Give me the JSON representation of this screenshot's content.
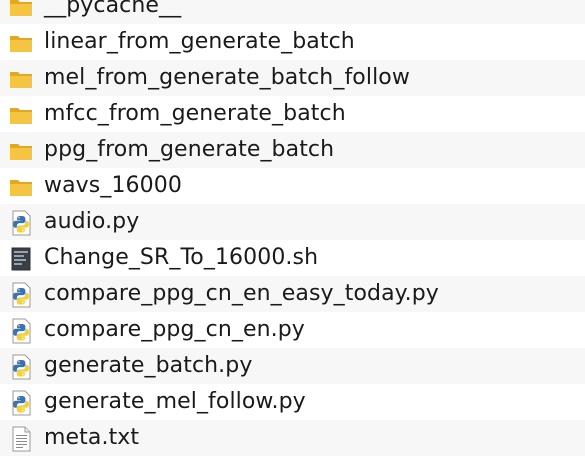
{
  "files": [
    {
      "name": "__pycache__",
      "kind": "folder"
    },
    {
      "name": "linear_from_generate_batch",
      "kind": "folder"
    },
    {
      "name": "mel_from_generate_batch_follow",
      "kind": "folder"
    },
    {
      "name": "mfcc_from_generate_batch",
      "kind": "folder"
    },
    {
      "name": "ppg_from_generate_batch",
      "kind": "folder"
    },
    {
      "name": "wavs_16000",
      "kind": "folder"
    },
    {
      "name": "audio.py",
      "kind": "python"
    },
    {
      "name": "Change_SR_To_16000.sh",
      "kind": "shell"
    },
    {
      "name": "compare_ppg_cn_en_easy_today.py",
      "kind": "python"
    },
    {
      "name": "compare_ppg_cn_en.py",
      "kind": "python"
    },
    {
      "name": "generate_batch.py",
      "kind": "python"
    },
    {
      "name": "generate_mel_follow.py",
      "kind": "python"
    },
    {
      "name": "meta.txt",
      "kind": "text"
    }
  ],
  "colors": {
    "folder": "#f5c542",
    "folder_dark": "#e2a91f",
    "python_blue": "#3b73b0",
    "python_yellow": "#f2d13c",
    "alt_row": "#f7f7f7"
  }
}
